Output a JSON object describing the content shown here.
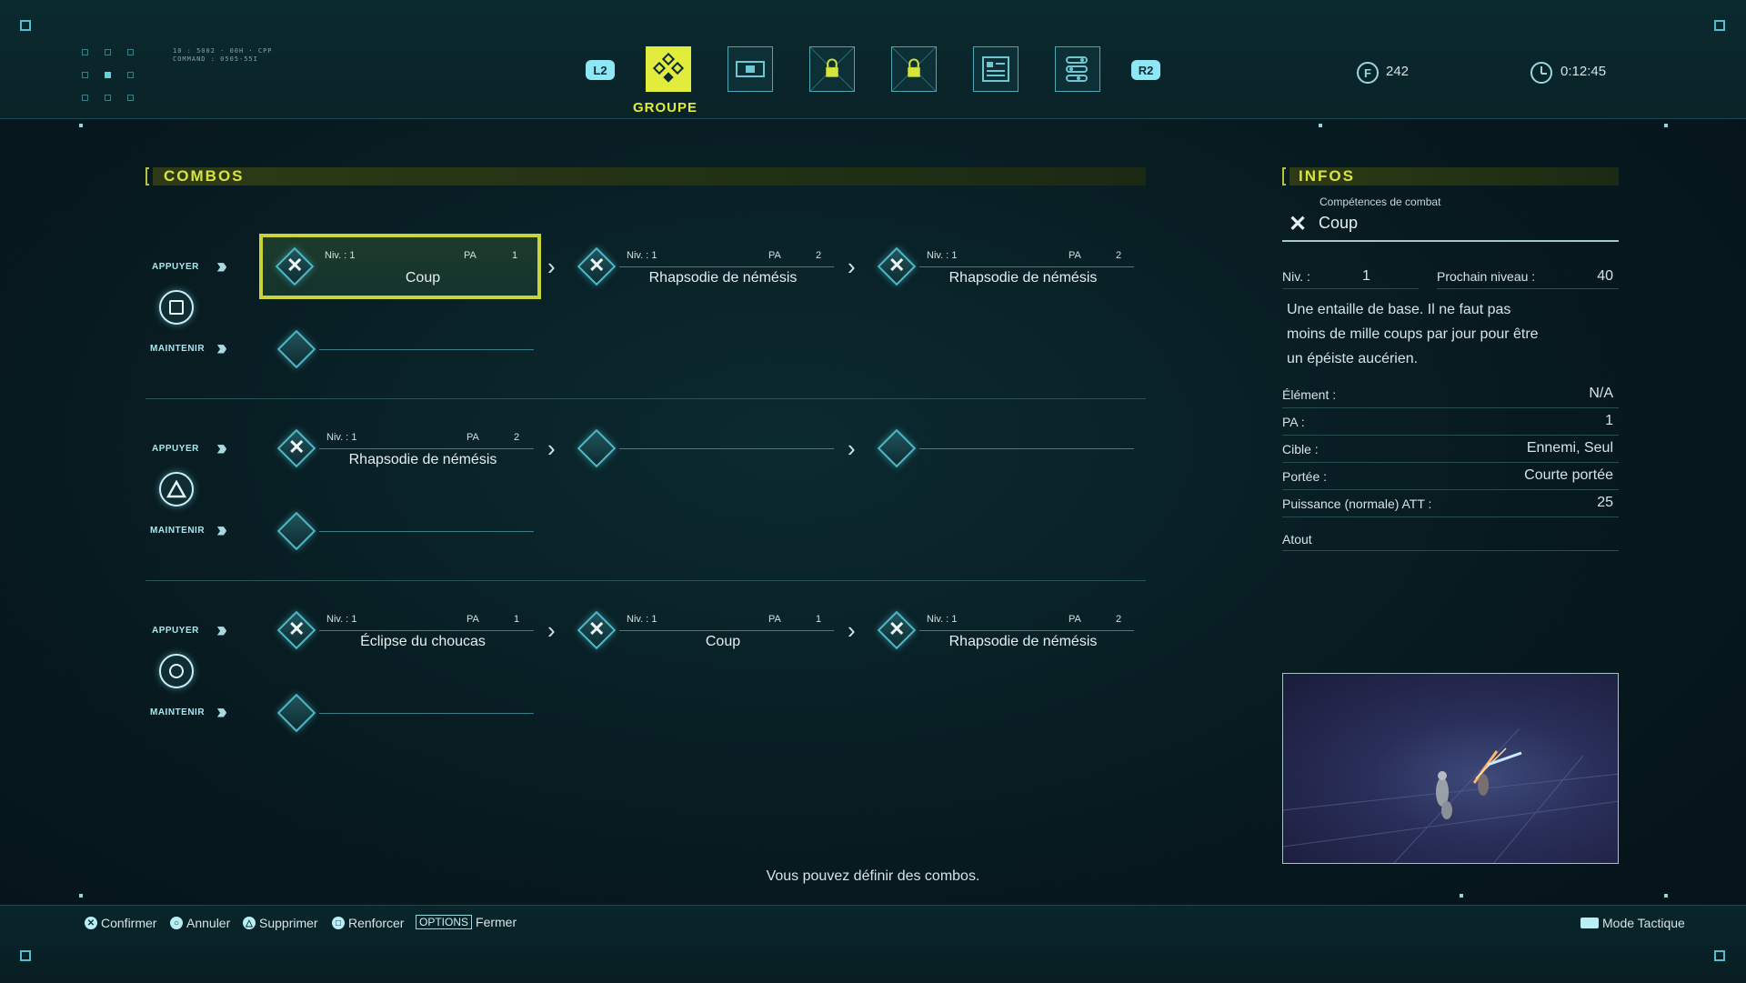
{
  "header": {
    "code_lines": [
      "10 : 5002 · 00H · CPP",
      "COMMAND : 0505-55I"
    ],
    "left_button": "L2",
    "right_button": "R2",
    "active_tab_label": "GROUPE",
    "currency_value": "242",
    "time": "0:12:45"
  },
  "combos": {
    "title": "COMBOS",
    "press_label": "APPUYER",
    "hold_label": "MAINTENIR",
    "level_label": "Niv. :",
    "pa_label": "PA",
    "rows": [
      {
        "button": "square",
        "press": [
          {
            "level": "1",
            "pa": "1",
            "name": "Coup",
            "selected": true
          },
          {
            "level": "1",
            "pa": "2",
            "name": "Rhapsodie de némésis"
          },
          {
            "level": "1",
            "pa": "2",
            "name": "Rhapsodie de némésis"
          }
        ]
      },
      {
        "button": "triangle",
        "press": [
          {
            "level": "1",
            "pa": "2",
            "name": "Rhapsodie de némésis"
          },
          null,
          null
        ]
      },
      {
        "button": "circle",
        "press": [
          {
            "level": "1",
            "pa": "1",
            "name": "Éclipse du choucas"
          },
          {
            "level": "1",
            "pa": "1",
            "name": "Coup"
          },
          {
            "level": "1",
            "pa": "2",
            "name": "Rhapsodie de némésis"
          }
        ]
      }
    ]
  },
  "infos": {
    "title": "INFOS",
    "category": "Compétences de combat",
    "skill_name": "Coup",
    "level_label": "Niv. :",
    "level_value": "1",
    "next_level_label": "Prochain niveau :",
    "next_level_value": "40",
    "description": [
      "Une entaille de base. Il ne faut pas",
      "moins de mille coups par jour pour être",
      "un épéiste aucérien."
    ],
    "rows": [
      {
        "label": "Élément :",
        "value": "N/A"
      },
      {
        "label": "PA :",
        "value": "1"
      },
      {
        "label": "Cible :",
        "value": "Ennemi, Seul"
      },
      {
        "label": "Portée :",
        "value": "Courte portée"
      },
      {
        "label": "Puissance (normale) ATT :",
        "value": "25"
      }
    ],
    "perk_label": "Atout"
  },
  "footer": {
    "message": "Vous pouvez définir des combos.",
    "confirm": "Confirmer",
    "cancel": "Annuler",
    "delete": "Supprimer",
    "reinforce": "Renforcer",
    "options_key": "OPTIONS",
    "close": "Fermer",
    "tactical_mode": "Mode Tactique"
  },
  "colors": {
    "accent": "#e2ec3c",
    "cyan": "#5fd3e0",
    "background": "#071a1f"
  }
}
